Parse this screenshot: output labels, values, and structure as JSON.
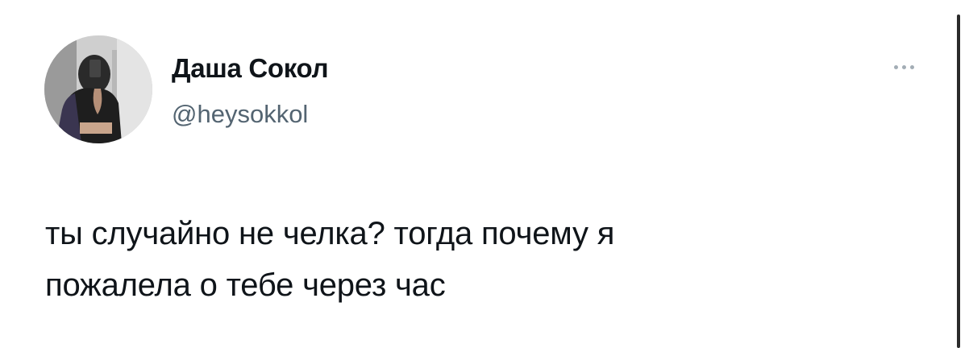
{
  "author": {
    "display_name": "Даша Сокол",
    "handle": "@heysokkol",
    "avatar_icon": "profile-photo"
  },
  "menu": {
    "icon": "more-horizontal-icon"
  },
  "tweet": {
    "lines": [
      "ты случайно не челка? тогда почему я",
      "пожалела о тебе через час"
    ]
  },
  "colors": {
    "text": "#0f1419",
    "secondary": "#536471",
    "menu_dots": "#a3adb5"
  }
}
